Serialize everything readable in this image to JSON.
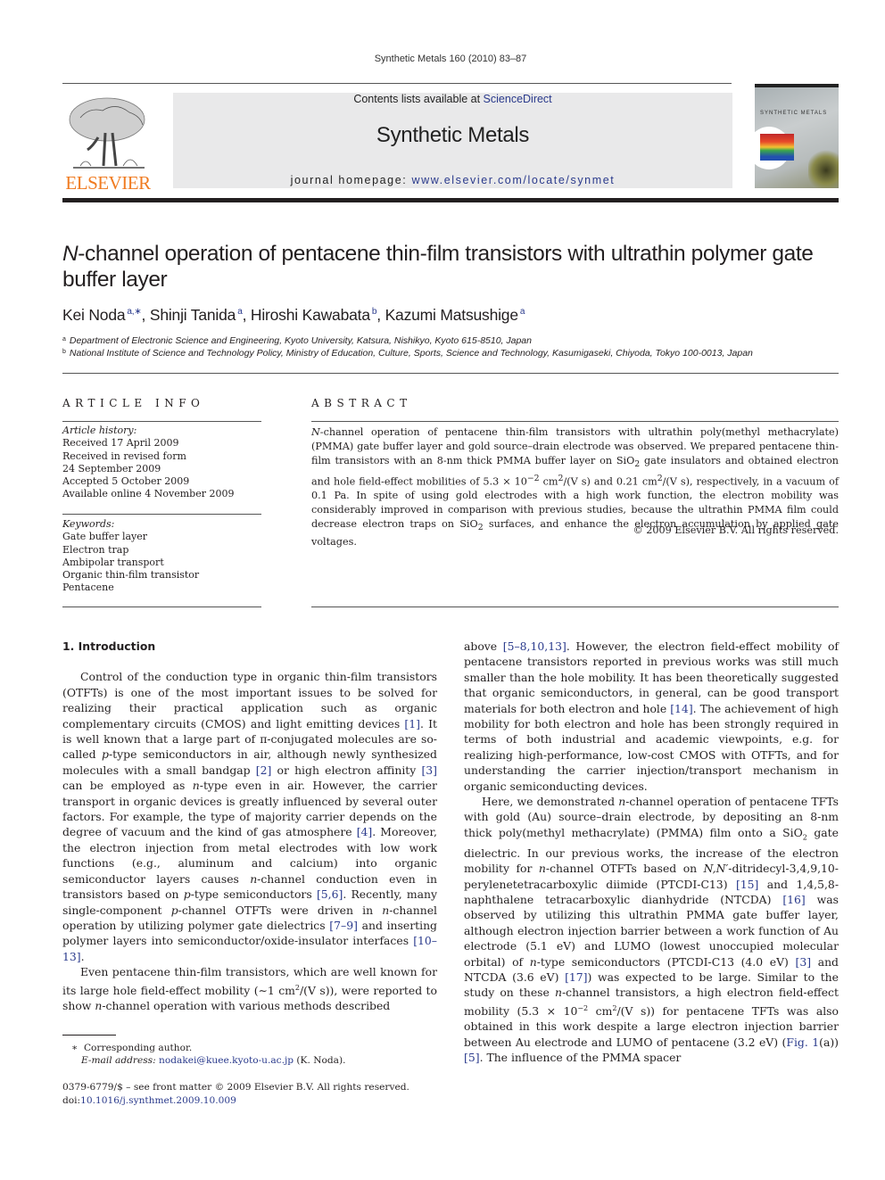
{
  "header": {
    "citation": "Synthetic Metals 160 (2010) 83–87",
    "contents_prefix": "Contents lists available at ",
    "contents_link": "ScienceDirect",
    "journal_name": "Synthetic Metals",
    "homepage_prefix": "journal homepage: ",
    "homepage_link": "www.elsevier.com/locate/synmet",
    "publisher": "ELSEVIER",
    "cover_title": "SYNTHETIC METALS"
  },
  "article": {
    "title_italic": "N",
    "title_rest": "-channel operation of pentacene thin-film transistors with ultrathin polymer gate buffer layer",
    "authors": [
      {
        "name": "Kei Noda",
        "sup": "a,∗"
      },
      {
        "name": "Shinji Tanida",
        "sup": "a"
      },
      {
        "name": "Hiroshi Kawabata",
        "sup": "b"
      },
      {
        "name": "Kazumi Matsushige",
        "sup": "a"
      }
    ],
    "affiliations": [
      {
        "mark": "a",
        "text": "Department of Electronic Science and Engineering, Kyoto University, Katsura, Nishikyo, Kyoto 615-8510, Japan"
      },
      {
        "mark": "b",
        "text": "National Institute of Science and Technology Policy, Ministry of Education, Culture, Sports, Science and Technology, Kasumigaseki, Chiyoda, Tokyo 100-0013, Japan"
      }
    ]
  },
  "article_info": {
    "heading": "ARTICLE INFO",
    "history_label": "Article history:",
    "history": [
      "Received 17 April 2009",
      "Received in revised form",
      "24 September 2009",
      "Accepted 5 October 2009",
      "Available online 4 November 2009"
    ],
    "keywords_label": "Keywords:",
    "keywords": [
      "Gate buffer layer",
      "Electron trap",
      "Ambipolar transport",
      "Organic thin-film transistor",
      "Pentacene"
    ]
  },
  "abstract": {
    "heading": "ABSTRACT",
    "n_italic": "N",
    "p1": "-channel operation of pentacene thin-film transistors with ultrathin poly(methyl methacrylate) (PMMA) gate buffer layer and gold source–drain electrode was observed. We prepared pentacene thin-film transistors with an 8-nm thick PMMA buffer layer on SiO",
    "sub1": "2",
    "p2": " gate insulators and obtained electron and hole field-effect mobilities of 5.3 × 10",
    "sup1": "−2",
    "p3": " cm",
    "sup2": "2",
    "p4": "/(V s) and 0.21 cm",
    "sup3": "2",
    "p5": "/(V s), respectively, in a vacuum of 0.1 Pa. In spite of using gold electrodes with a high work function, the electron mobility was considerably improved in comparison with previous studies, because the ultrathin PMMA film could decrease electron traps on SiO",
    "sub2": "2",
    "p6": " surfaces, and enhance the electron accumulation by applied gate voltages.",
    "copyright": "© 2009 Elsevier B.V. All rights reserved."
  },
  "body": {
    "section_heading": "1.  Introduction",
    "left": {
      "para1": [
        {
          "t": "Control of the conduction type in organic thin-film transistors (OTFTs) is one of the most important issues to be solved for realizing their practical application such as organic complementary circuits (CMOS) and light emitting devices "
        },
        {
          "ref": "[1]"
        },
        {
          "t": ". It is well known that a large part of π-conjugated molecules are so-called "
        },
        {
          "i": "p"
        },
        {
          "t": "-type semiconductors in air, although newly synthesized molecules with a small bandgap "
        },
        {
          "ref": "[2]"
        },
        {
          "t": " or high electron affinity "
        },
        {
          "ref": "[3]"
        },
        {
          "t": " can be employed as "
        },
        {
          "i": "n"
        },
        {
          "t": "-type even in air. However, the carrier transport in organic devices is greatly influenced by several outer factors. For example, the type of majority carrier depends on the degree of vacuum and the kind of gas atmosphere "
        },
        {
          "ref": "[4]"
        },
        {
          "t": ". Moreover, the electron injection from metal electrodes with low work functions (e.g., aluminum and calcium) into organic semiconductor layers causes "
        },
        {
          "i": "n"
        },
        {
          "t": "-channel conduction even in transistors based on "
        },
        {
          "i": "p"
        },
        {
          "t": "-type semiconductors "
        },
        {
          "ref": "[5,6]"
        },
        {
          "t": ". Recently, many single-component "
        },
        {
          "i": "p"
        },
        {
          "t": "-channel OTFTs were driven in "
        },
        {
          "i": "n"
        },
        {
          "t": "-channel operation by utilizing polymer gate dielectrics "
        },
        {
          "ref": "[7–9]"
        },
        {
          "t": " and inserting polymer layers into semiconductor/oxide-insulator interfaces "
        },
        {
          "ref": "[10–13]"
        },
        {
          "t": "."
        }
      ],
      "para2": [
        {
          "t": "Even pentacene thin-film transistors, which are well known for its large hole field-effect mobility (∼1 cm"
        },
        {
          "sup": "2"
        },
        {
          "t": "/(V s)), were reported to show "
        },
        {
          "i": "n"
        },
        {
          "t": "-channel operation with various methods described"
        }
      ]
    },
    "right": {
      "para1": [
        {
          "t": "above "
        },
        {
          "ref": "[5–8,10,13]"
        },
        {
          "t": ". However, the electron field-effect mobility of pentacene transistors reported in previous works was still much smaller than the hole mobility. It has been theoretically suggested that organic semiconductors, in general, can be good transport materials for both electron and hole "
        },
        {
          "ref": "[14]"
        },
        {
          "t": ". The achievement of high mobility for both electron and hole has been strongly required in terms of both industrial and academic viewpoints, e.g. for realizing high-performance, low-cost CMOS with OTFTs, and for understanding the carrier injection/transport mechanism in organic semiconducting devices."
        }
      ],
      "para2": [
        {
          "t": "Here, we demonstrated "
        },
        {
          "i": "n"
        },
        {
          "t": "-channel operation of pentacene TFTs with gold (Au) source–drain electrode, by depositing an 8-nm thick poly(methyl methacrylate) (PMMA) film onto a SiO"
        },
        {
          "sub": "2"
        },
        {
          "t": " gate dielectric. In our previous works, the increase of the electron mobility for "
        },
        {
          "i": "n"
        },
        {
          "t": "-channel OTFTs based on "
        },
        {
          "i": "N,N′"
        },
        {
          "t": "-ditridecyl-3,4,9,10-perylenetetracarboxylic diimide (PTCDI-C13) "
        },
        {
          "ref": "[15]"
        },
        {
          "t": " and 1,4,5,8-naphthalene tetracarboxylic dianhydride (NTCDA) "
        },
        {
          "ref": "[16]"
        },
        {
          "t": " was observed by utilizing this ultrathin PMMA gate buffer layer, although electron injection barrier between a work function of Au electrode (5.1 eV) and LUMO (lowest unoccupied molecular orbital) of "
        },
        {
          "i": "n"
        },
        {
          "t": "-type semiconductors (PTCDI-C13 (4.0 eV) "
        },
        {
          "ref": "[3]"
        },
        {
          "t": " and NTCDA (3.6 eV) "
        },
        {
          "ref": "[17]"
        },
        {
          "t": ") was expected to be large. Similar to the study on these "
        },
        {
          "i": "n"
        },
        {
          "t": "-channel transistors, a high electron field-effect mobility (5.3 × 10"
        },
        {
          "sup": "−2"
        },
        {
          "t": " cm"
        },
        {
          "sup": "2"
        },
        {
          "t": "/(V s)) for pentacene TFTs was also obtained in this work despite a large electron injection barrier between Au electrode and LUMO of pentacene (3.2 eV) ("
        },
        {
          "ref": "Fig. 1"
        },
        {
          "t": "(a)) "
        },
        {
          "ref": "[5]"
        },
        {
          "t": ". The influence of the PMMA spacer"
        }
      ]
    }
  },
  "footnote": {
    "mark": "∗",
    "corresponding": "Corresponding author.",
    "email_label": "E-mail address:",
    "email": "nodakei@kuee.kyoto-u.ac.jp",
    "email_suffix": " (K. Noda).",
    "issn_line": "0379-6779/$ – see front matter © 2009 Elsevier B.V. All rights reserved.",
    "doi_prefix": "doi:",
    "doi": "10.1016/j.synthmet.2009.10.009"
  },
  "colors": {
    "link": "#2a3a8c",
    "elsevier_orange": "#f07b21",
    "masthead_bg": "#e9e9ea"
  }
}
